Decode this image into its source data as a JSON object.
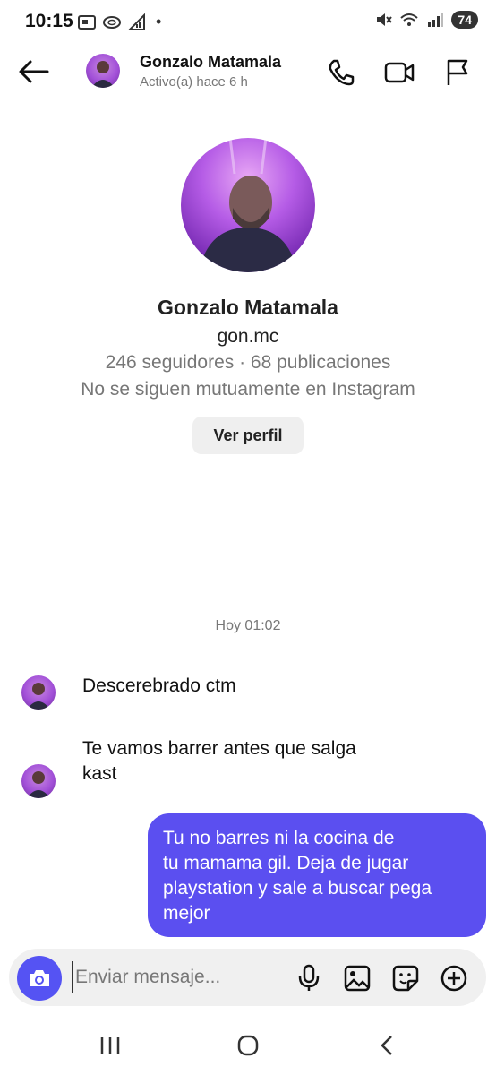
{
  "status_bar": {
    "time": "10:15",
    "dot": "•",
    "battery": "74",
    "left_icons": [
      "screenshot-icon",
      "data-saver-icon",
      "signal-transfer-icon"
    ],
    "right_icons": [
      "mute-icon",
      "wifi-icon",
      "signal-icon"
    ]
  },
  "header": {
    "name": "Gonzalo Matamala",
    "status": "Activo(a) hace 6 h"
  },
  "profile": {
    "name": "Gonzalo Matamala",
    "username": "gon.mc",
    "stats": "246 seguidores · 68 publicaciones",
    "follow_status": "No se siguen mutuamente en Instagram",
    "view_profile_label": "Ver perfil"
  },
  "conversation": {
    "timestamp": "Hoy 01:02",
    "received": [
      {
        "line1": "Descerebrado ctm",
        "line2": ""
      },
      {
        "line1": "Te vamos barrer antes que salga",
        "line2": "kast"
      }
    ],
    "sent": [
      {
        "lines": [
          "Tu no barres ni la cocina de",
          "tu mamama gil. Deja de jugar",
          "playstation y sale a buscar pega",
          "mejor"
        ]
      }
    ]
  },
  "composer": {
    "placeholder": "Enviar mensaje..."
  },
  "colors": {
    "accent": "#5553f3",
    "sent_bubble": "#5b4ff0",
    "composer_bg": "#f0f0f0"
  }
}
